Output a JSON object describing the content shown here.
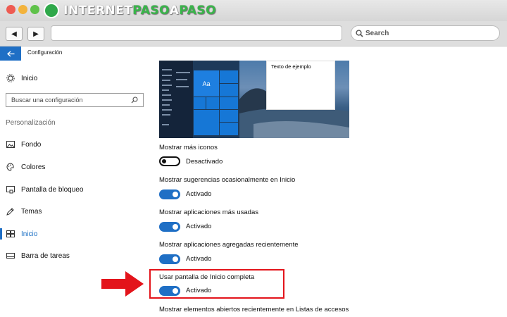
{
  "browser": {
    "logo": {
      "part1": "INTERNET",
      "part2": "PASO",
      "part3": "A",
      "part4": "PASO"
    },
    "search_placeholder": "Search",
    "back_label": "◀",
    "forward_label": "▶"
  },
  "app": {
    "title": "Configuración",
    "back_icon": "back-arrow-icon"
  },
  "sidebar": {
    "home": "Inicio",
    "search_placeholder": "Buscar una configuración",
    "section": "Personalización",
    "items": [
      {
        "label": "Fondo",
        "icon": "image-icon"
      },
      {
        "label": "Colores",
        "icon": "palette-icon"
      },
      {
        "label": "Pantalla de bloqueo",
        "icon": "lock-screen-icon"
      },
      {
        "label": "Temas",
        "icon": "brush-icon"
      },
      {
        "label": "Inicio",
        "icon": "start-icon",
        "active": true
      },
      {
        "label": "Barra de tareas",
        "icon": "taskbar-icon"
      }
    ]
  },
  "preview": {
    "sample_text": "Texto de ejemplo",
    "tile_label": "Aa"
  },
  "settings": [
    {
      "label": "Mostrar más iconos",
      "state": "Desactivado",
      "on": false
    },
    {
      "label": "Mostrar sugerencias ocasionalmente en Inicio",
      "state": "Activado",
      "on": true
    },
    {
      "label": "Mostrar aplicaciones más usadas",
      "state": "Activado",
      "on": true
    },
    {
      "label": "Mostrar aplicaciones agregadas recientemente",
      "state": "Activado",
      "on": true
    },
    {
      "label": "Usar pantalla de Inicio completa",
      "state": "Activado",
      "on": true
    }
  ],
  "last_setting_label": "Mostrar elementos abiertos recientemente en Listas de accesos",
  "colors": {
    "accent": "#1f6fc5",
    "highlight": "#e3141b"
  }
}
